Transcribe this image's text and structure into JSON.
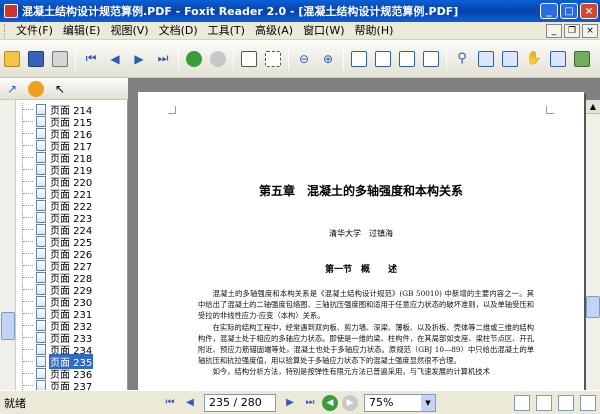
{
  "window": {
    "title": "混凝土结构设计规范算例.PDF - Foxit Reader 2.0 - [混凝土结构设计规范算例.PDF]"
  },
  "menu": [
    "文件(F)",
    "编辑(E)",
    "视图(V)",
    "文档(D)",
    "工具(T)",
    "高级(A)",
    "窗口(W)",
    "帮助(H)"
  ],
  "toolbar_icons": [
    "open-folder-icon",
    "save-icon",
    "print-icon",
    "first-page-icon",
    "prev-page-icon",
    "next-page-icon",
    "last-page-icon",
    "back-icon",
    "forward-icon",
    "select-text-icon",
    "snapshot-icon",
    "zoom-out-icon",
    "zoom-in-icon",
    "single-page-icon",
    "continuous-icon",
    "facing-icon",
    "find-icon",
    "bookmarks-icon",
    "thumbnails-icon",
    "hand-icon",
    "rotate-icon",
    "image-icon"
  ],
  "sidebar": {
    "pages": [
      {
        "label": "页面 214",
        "selected": false
      },
      {
        "label": "页面 215",
        "selected": false
      },
      {
        "label": "页面 216",
        "selected": false
      },
      {
        "label": "页面 217",
        "selected": false
      },
      {
        "label": "页面 218",
        "selected": false
      },
      {
        "label": "页面 219",
        "selected": false
      },
      {
        "label": "页面 220",
        "selected": false
      },
      {
        "label": "页面 221",
        "selected": false
      },
      {
        "label": "页面 222",
        "selected": false
      },
      {
        "label": "页面 223",
        "selected": false
      },
      {
        "label": "页面 224",
        "selected": false
      },
      {
        "label": "页面 225",
        "selected": false
      },
      {
        "label": "页面 226",
        "selected": false
      },
      {
        "label": "页面 227",
        "selected": false
      },
      {
        "label": "页面 228",
        "selected": false
      },
      {
        "label": "页面 229",
        "selected": false
      },
      {
        "label": "页面 230",
        "selected": false
      },
      {
        "label": "页面 231",
        "selected": false
      },
      {
        "label": "页面 232",
        "selected": false
      },
      {
        "label": "页面 233",
        "selected": false
      },
      {
        "label": "页面 234",
        "selected": false
      },
      {
        "label": "页面 235",
        "selected": true
      },
      {
        "label": "页面 236",
        "selected": false
      },
      {
        "label": "页面 237",
        "selected": false
      }
    ]
  },
  "document": {
    "chapter_title": "第五章　混凝土的多轴强度和本构关系",
    "authors": "清华大学　过镇海",
    "section_title": "第一节　概　　述",
    "paragraphs": [
      "混凝土的多轴强度和本构关系是《混凝土结构设计规范》(GB 50010) 中新增的主要内容之一。其中给出了混凝土的二轴强度包络图、三轴抗压强度图和适用于任意应力状态的破坏准则，以及单轴受压和受拉的非线性应力-应变（本构）关系。",
      "在实际的结构工程中，经常遇到双向板、剪力墙、深梁、薄板、以及折板、壳体等二维或三维的结构构件，混凝土处于相应的多轴应力状态。即使是一维的梁、柱构件，在其局部如支座、梁柱节点区、开孔附近、预应力筋锚固端等处，混凝土也处于多轴应力状态。原规范（GBJ 10—89）中只给出混凝土的单轴抗压和抗拉强度值，用以验算处于多轴应力状态下的混凝土强度显然很不合理。",
      "如今，结构分析方法，特别是按弹性有限元方法已普遍采用，与飞速发展的计算机技术"
    ]
  },
  "status": {
    "text": "就绪",
    "page_indicator": "235 / 280",
    "zoom": "75%"
  }
}
